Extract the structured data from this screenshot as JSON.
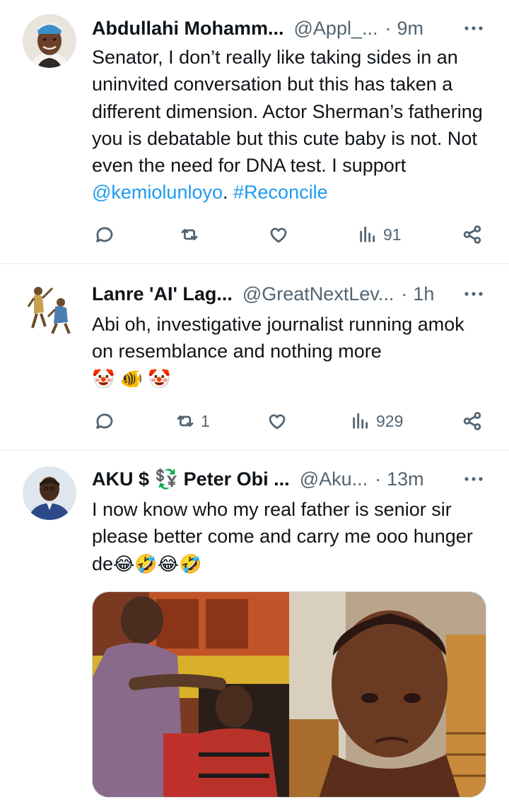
{
  "tweets": [
    {
      "name": "Abdullahi Mohamm...",
      "handle": "@Appl_...",
      "dot": "·",
      "time": "9m",
      "text_before": "Senator, I don’t really like taking sides in an uninvited conversation but this has taken a different dimension. Actor Sherman’s fathering you is debatable but this cute baby is not. Not even the need for DNA test. I support ",
      "mention": "@kemiolunloyo",
      "text_mid": ". ",
      "hashtag": "#Reconcile",
      "retweets": "",
      "views": "91"
    },
    {
      "name": "Lanre 'AI' Lag...",
      "handle": "@GreatNextLev...",
      "dot": "·",
      "time": "1h",
      "text": "Abi oh, investigative journalist running amok on resemblance and nothing more",
      "emojis": "🤡 🐠 🤡",
      "retweets": "1",
      "views": "929"
    },
    {
      "name": "AKU $ 💱 Peter Obi ...",
      "handle": "@Aku...",
      "dot": "·",
      "time": "13m",
      "text": "I now know who my real father is senior sir please better come and carry me ooo hunger de",
      "emojis": "😂🤣😂🤣"
    }
  ],
  "icons": {
    "reply": "reply-icon",
    "retweet": "retweet-icon",
    "like": "heart-icon",
    "views": "views-icon",
    "share": "share-icon",
    "more": "more-icon"
  },
  "colors": {
    "link": "#1d9bf0",
    "secondary_text": "#536471",
    "divider": "#eff3f4"
  }
}
